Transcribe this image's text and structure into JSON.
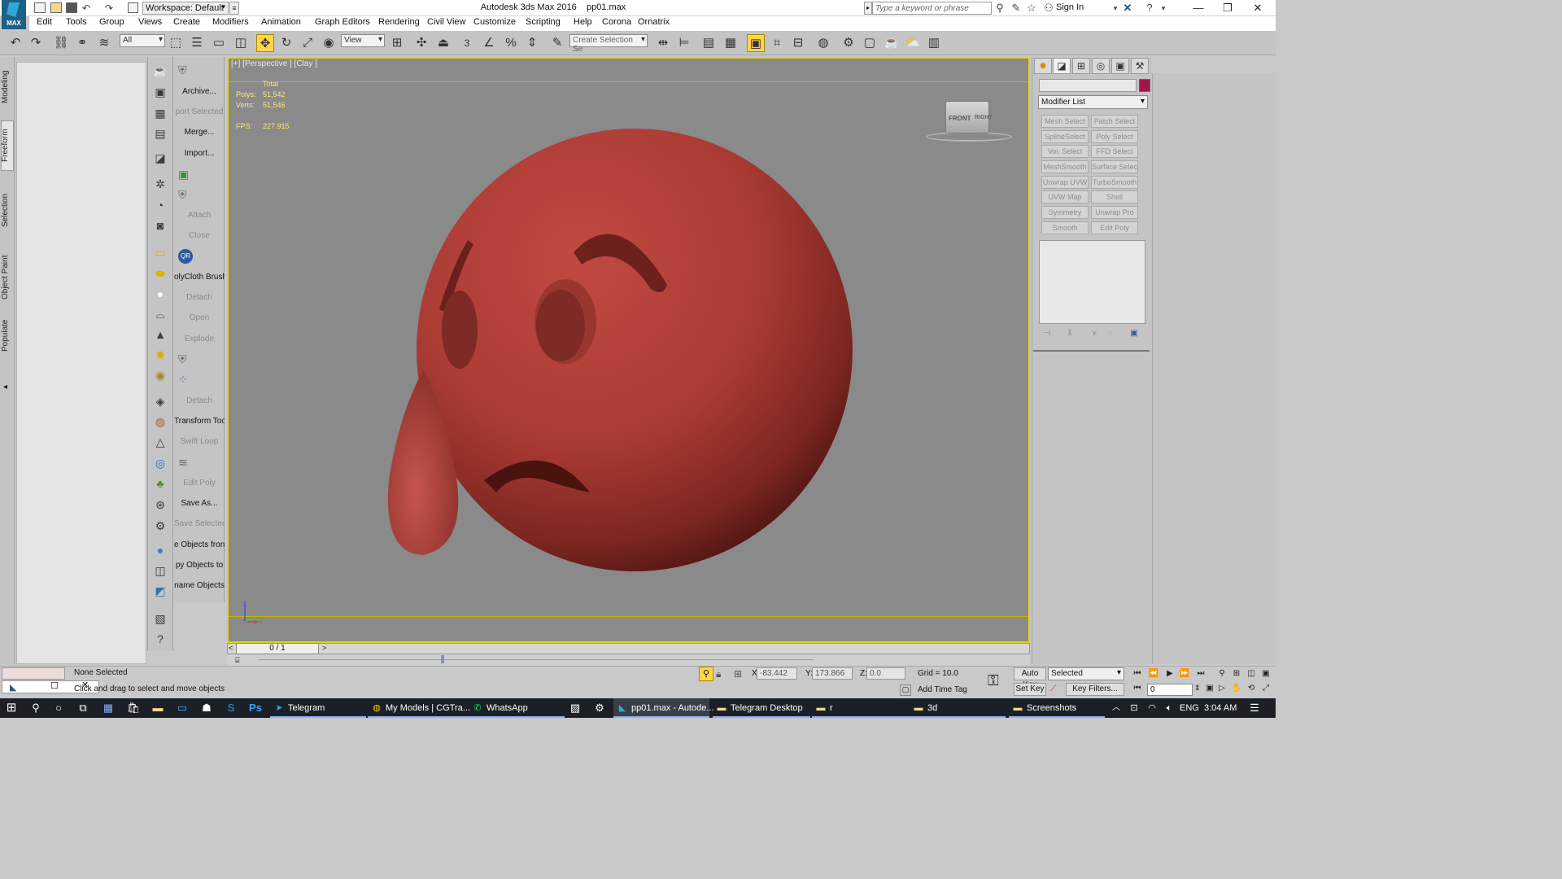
{
  "window": {
    "title": "Autodesk 3ds Max 2016",
    "file_name": "pp01.max",
    "app_logo_text": "MAX",
    "workspace": "Workspace: Default",
    "search_placeholder": "Type a keyword or phrase",
    "sign_in": "Sign In"
  },
  "menu": [
    "Edit",
    "Tools",
    "Group",
    "Views",
    "Create",
    "Modifiers",
    "Animation",
    "Graph Editors",
    "Rendering",
    "Civil View",
    "Customize",
    "Scripting",
    "Help",
    "Corona",
    "Ornatrix"
  ],
  "toolbar": {
    "selection_filter": "All",
    "reference_coordinate": "View",
    "snap_label": "3",
    "named_selection_placeholder": "Create Selection Se"
  },
  "ribbon_tabs": [
    "Modeling",
    "Freeform",
    "Selection",
    "Object Paint",
    "Populate"
  ],
  "command_column": [
    {
      "label": "Archive...",
      "enabled": true
    },
    {
      "label": "port Selected",
      "enabled": false
    },
    {
      "label": "Merge...",
      "enabled": true
    },
    {
      "label": "Import...",
      "enabled": true
    },
    {
      "label": "Attach",
      "enabled": false
    },
    {
      "label": "Close",
      "enabled": false
    },
    {
      "label": "olyCloth Brush",
      "enabled": true
    },
    {
      "label": "Detach",
      "enabled": false
    },
    {
      "label": "Open",
      "enabled": false
    },
    {
      "label": "Explode",
      "enabled": false
    },
    {
      "label": "Detach",
      "enabled": false
    },
    {
      "label": "Transform Tool",
      "enabled": true
    },
    {
      "label": "Swift Loop",
      "enabled": false
    },
    {
      "label": "Edit Poly",
      "enabled": false
    },
    {
      "label": "Save As...",
      "enabled": true
    },
    {
      "label": "Save Selected",
      "enabled": false
    },
    {
      "label": "e Objects fron",
      "enabled": true
    },
    {
      "label": "py Objects to",
      "enabled": true
    },
    {
      "label": "name Objects",
      "enabled": true
    }
  ],
  "viewport": {
    "label": "[+] [Perspective ] [Clay ]",
    "stats_header": "Total",
    "polys_label": "Polys:",
    "polys_value": "51,542",
    "verts_label": "Verts:",
    "verts_value": "51,546",
    "fps_label": "FPS:",
    "fps_value": "227.915",
    "viewcube_front": "FRONT",
    "viewcube_right": "RIGHT",
    "axis_z": "z",
    "axis_x": "x",
    "axis_y": "y"
  },
  "time_slider": {
    "frame_display": "0 / 1"
  },
  "command_panel": {
    "modifier_list": "Modifier List",
    "modifier_buttons": [
      "Mesh Select",
      "Patch Select",
      "SplineSelect",
      "Poly Select",
      "Vol. Select",
      "FFD Select",
      "MeshSmooth",
      "Surface Select",
      "Unwrap UVW",
      "TurboSmooth",
      "UVW Map",
      "Shell",
      "Symmetry",
      "Unwrap Pro",
      "Smooth",
      "Edit Poly"
    ]
  },
  "status": {
    "selection": "None Selected",
    "prompt": "Click and drag to select and move objects",
    "x_label": "X:",
    "x_value": "-83.442",
    "y_label": "Y:",
    "y_value": "173.866",
    "z_label": "Z:",
    "z_value": "0.0",
    "grid": "Grid = 10.0",
    "add_time_tag": "Add Time Tag",
    "auto_key": "Auto Key",
    "set_key": "Set Key",
    "selected_dropdown": "Selected",
    "key_filters": "Key Filters...",
    "current_frame": "0"
  },
  "taskbar": {
    "apps": [
      {
        "label": "Telegram",
        "icon": "telegram-icon"
      },
      {
        "label": "My Models | CGTra...",
        "icon": "chrome-icon"
      },
      {
        "label": "WhatsApp",
        "icon": "whatsapp-icon"
      },
      {
        "label": "pp01.max - Autode...",
        "icon": "3dsmax-icon"
      },
      {
        "label": "Telegram Desktop",
        "icon": "folder-icon"
      },
      {
        "label": "r",
        "icon": "folder-icon"
      },
      {
        "label": "3d",
        "icon": "folder-icon"
      },
      {
        "label": "Screenshots",
        "icon": "folder-icon"
      }
    ],
    "language": "ENG",
    "time": "3:04 AM"
  },
  "colors": {
    "viewport_bg": "#8a8a8a",
    "active_viewport_border": "#e5d600",
    "model_red": "#b0413a",
    "stats_text": "#ffe96b",
    "ui_gray": "#c4c4c4",
    "taskbar": "#1c2026"
  }
}
